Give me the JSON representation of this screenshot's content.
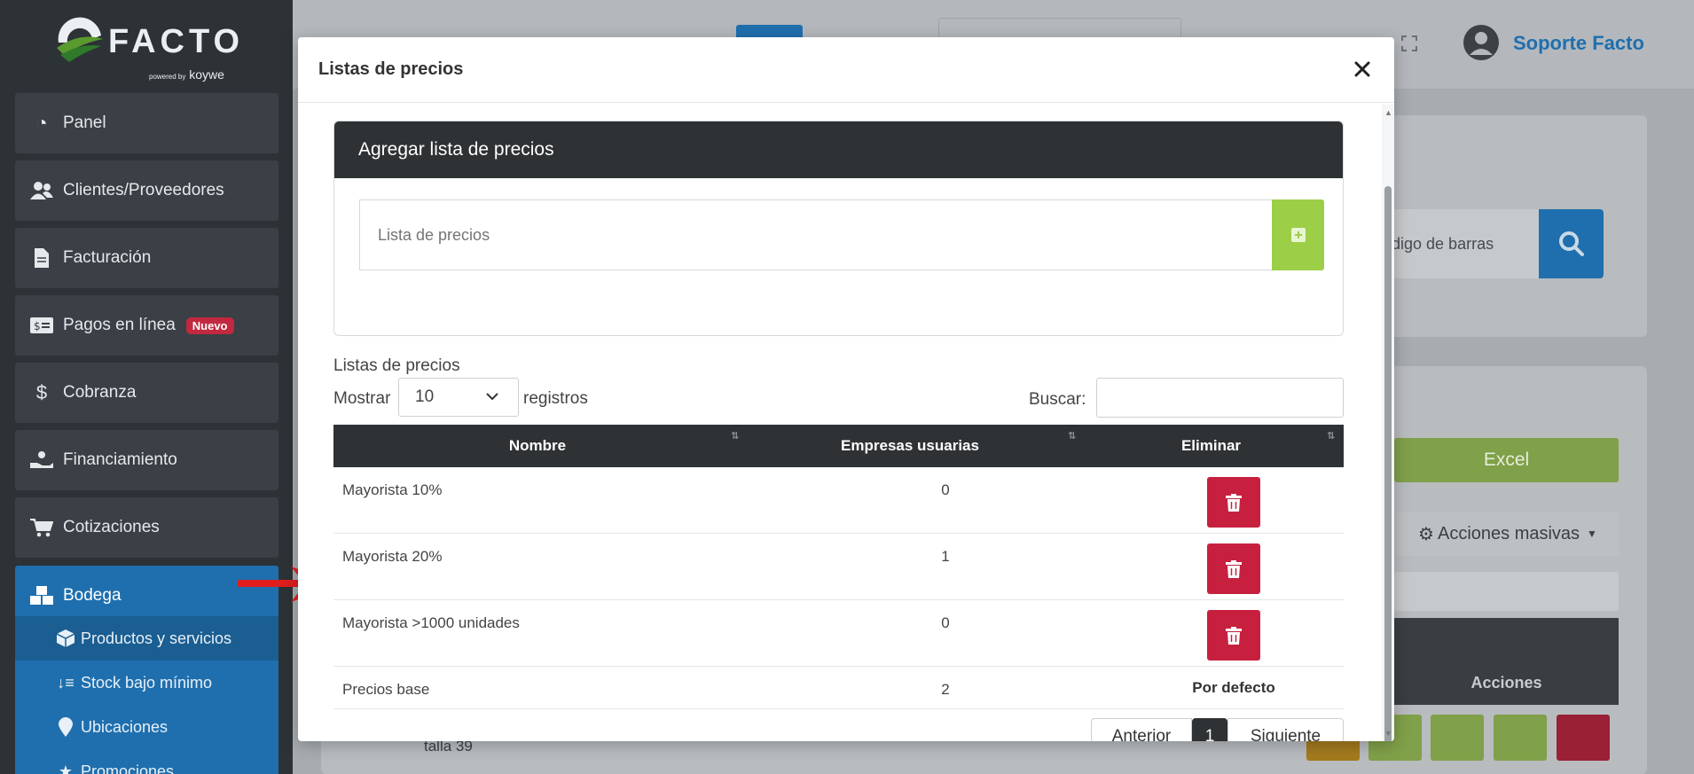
{
  "app": {
    "logo_text": "FACTO",
    "logo_sub_small": "powered by",
    "logo_sub": "koywe",
    "user_name": "Soporte Facto"
  },
  "sidebar": {
    "items": [
      {
        "label": "Panel",
        "icon": "pie-chart-icon"
      },
      {
        "label": "Clientes/Proveedores",
        "icon": "users-icon"
      },
      {
        "label": "Facturación",
        "icon": "document-icon"
      },
      {
        "label": "Pagos en línea",
        "icon": "money-card-icon",
        "badge": "Nuevo"
      },
      {
        "label": "Cobranza",
        "icon": "dollar-icon"
      },
      {
        "label": "Financiamiento",
        "icon": "hand-coin-icon"
      },
      {
        "label": "Cotizaciones",
        "icon": "cart-icon"
      },
      {
        "label": "Bodega",
        "icon": "boxes-icon"
      }
    ],
    "sub_items": [
      {
        "label": "Productos y servicios",
        "icon": "box-icon"
      },
      {
        "label": "Stock bajo mínimo",
        "icon": "sort-down-icon"
      },
      {
        "label": "Ubicaciones",
        "icon": "map-pin-icon"
      },
      {
        "label": "Promociones",
        "icon": "star-icon"
      }
    ]
  },
  "background": {
    "barcode_placeholder": "digo de barras",
    "excel_label": "Excel",
    "mass_actions_label": "Acciones masivas",
    "actions_header": "Acciones",
    "row_text": "talla 39",
    "colors": {
      "primary": "#1f6fae",
      "success": "#80a049",
      "danger": "#c7203f",
      "warning": "#d79a1f"
    }
  },
  "modal": {
    "title": "Listas de precios",
    "add_section": {
      "title": "Agregar lista de precios",
      "input_placeholder": "Lista de precios"
    },
    "list_label": "Listas de precios",
    "show_label": "Mostrar",
    "show_value": "10",
    "records_label": "registros",
    "search_label": "Buscar:",
    "table": {
      "headers": [
        "Nombre",
        "Empresas usuarias",
        "Eliminar"
      ],
      "rows": [
        {
          "name": "Mayorista 10%",
          "count": "0",
          "deletable": true
        },
        {
          "name": "Mayorista 20%",
          "count": "1",
          "deletable": true
        },
        {
          "name": "Mayorista >1000 unidades",
          "count": "0",
          "deletable": true
        },
        {
          "name": "Precios base",
          "count": "2",
          "deletable": false,
          "default_label": "Por defecto"
        }
      ]
    },
    "pagination": {
      "prev": "Anterior",
      "current": "1",
      "next": "Siguiente"
    }
  }
}
